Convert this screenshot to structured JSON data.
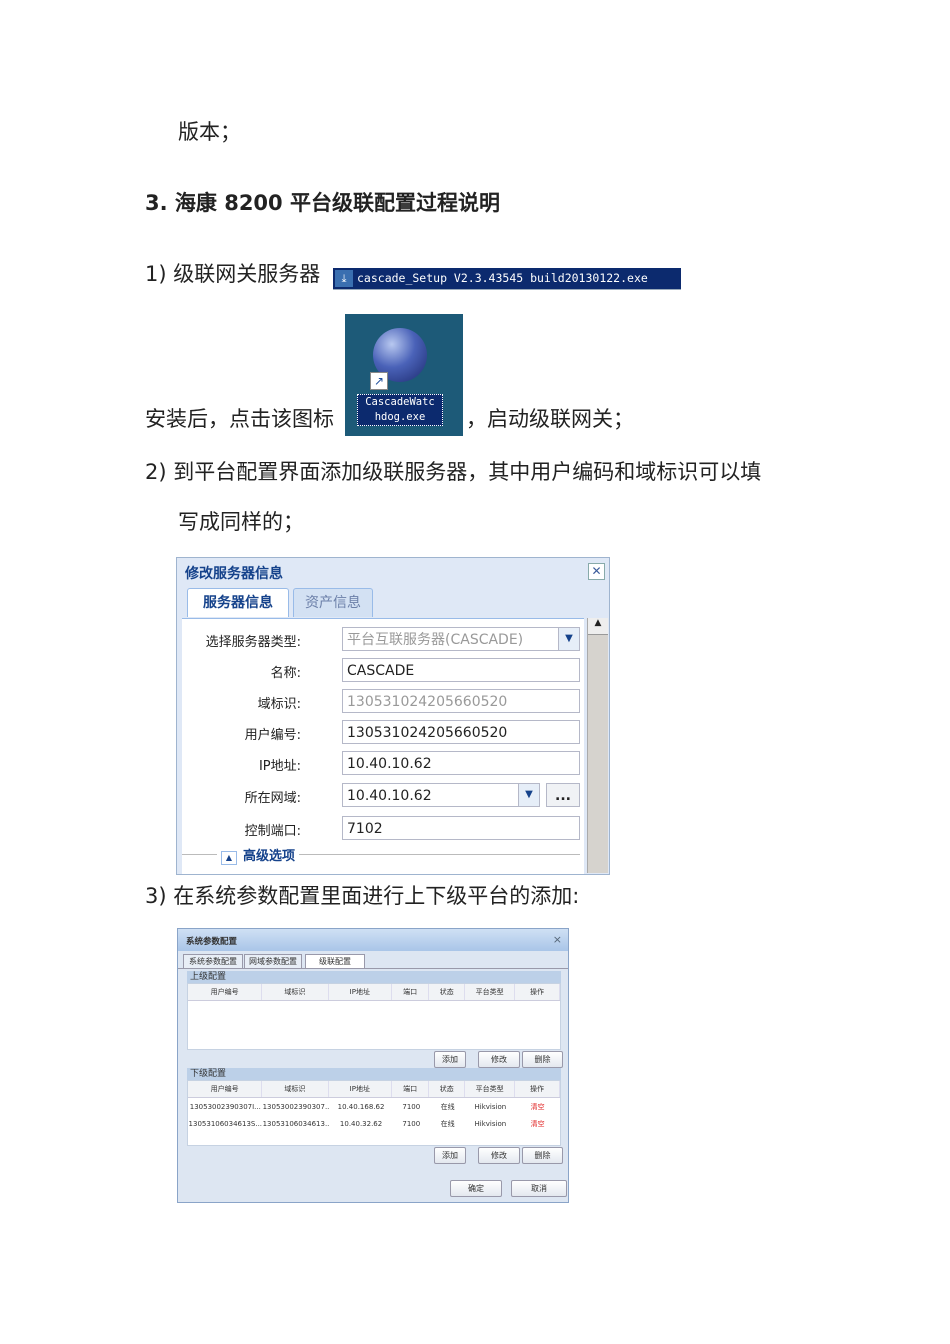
{
  "doc": {
    "line_version": "版本；",
    "heading": "3.  海康 8200 平台级联配置过程说明",
    "step1_label": "1)  级联网关服务器",
    "installer_file": "cascade_Setup V2.3.43545 build20130122.exe",
    "step1_after_install": "安装后，点击该图标",
    "icon_label_line1": "CascadeWatc",
    "icon_label_line2": "hdog.exe",
    "step1_start": "，启动级联网关；",
    "step2_line1": "2)  到平台配置界面添加级联服务器，其中用户编码和域标识可以填",
    "step2_line2": "写成同样的；",
    "step3": "3)  在系统参数配置里面进行上下级平台的添加:"
  },
  "server_dialog": {
    "title": "修改服务器信息",
    "close": "✕",
    "tabs": [
      "服务器信息",
      "资产信息"
    ],
    "fields": [
      {
        "label": "选择服务器类型:",
        "value": "平台互联服务器(CASCADE)"
      },
      {
        "label": "名称:",
        "value": "CASCADE"
      },
      {
        "label": "域标识:",
        "value": "130531024205660520"
      },
      {
        "label": "用户编号:",
        "value": "130531024205660520"
      },
      {
        "label": "IP地址:",
        "value": "10.40.10.62"
      },
      {
        "label": "所在网域:",
        "value": "10.40.10.62"
      },
      {
        "label": "控制端口:",
        "value": "7102"
      }
    ],
    "more_button": "...",
    "advanced": "高级选项"
  },
  "sys_dialog": {
    "title": "系统参数配置",
    "close": "×",
    "tabs": [
      "系统参数配置",
      "网域参数配置",
      "级联配置"
    ],
    "upper_section": "上级配置",
    "lower_section": "下级配置",
    "columns": [
      "用户编号",
      "域标识",
      "IP地址",
      "端口",
      "状态",
      "平台类型",
      "操作"
    ],
    "lower_rows": [
      [
        "13053002390307I...",
        "13053002390307...",
        "10.40.168.62",
        "7100",
        "在线",
        "Hikvision",
        "清空"
      ],
      [
        "13053106034613S...",
        "13053106034613...",
        "10.40.32.62",
        "7100",
        "在线",
        "Hikvision",
        "清空"
      ]
    ],
    "add": "添加",
    "modify": "修改",
    "delete": "删除",
    "ok": "确定",
    "cancel": "取消"
  }
}
